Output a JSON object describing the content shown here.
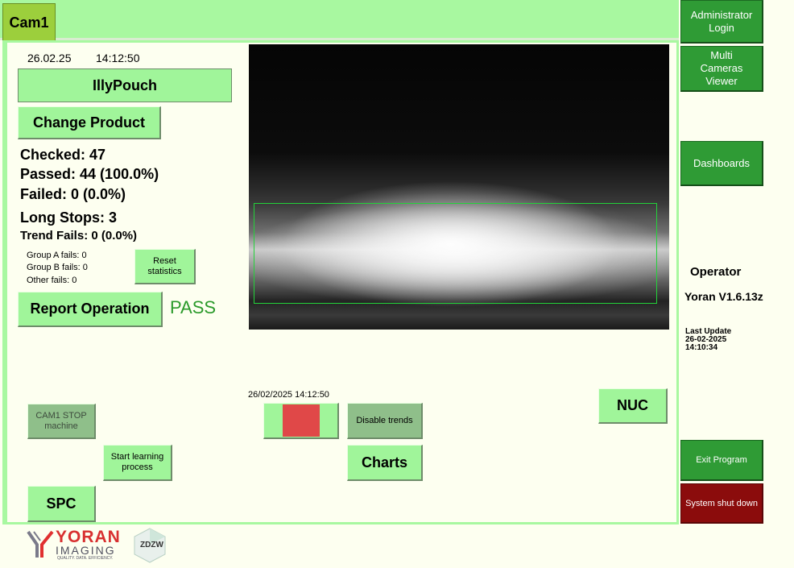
{
  "tab": {
    "label": "Cam1"
  },
  "header": {
    "date": "26.02.25",
    "time": "14:12:50"
  },
  "product": {
    "name": "IllyPouch",
    "change_label": "Change Product"
  },
  "stats": {
    "checked": "Checked: 47",
    "passed": "Passed: 44 (100.0%)",
    "failed": "Failed: 0 (0.0%)",
    "long_stops": "Long Stops: 3",
    "trend_fails": "Trend Fails: 0 (0.0%)",
    "group_a": "Group A fails: 0",
    "group_b": "Group B fails: 0",
    "other": "Other fails: 0"
  },
  "buttons": {
    "reset": "Reset statistics",
    "report": "Report Operation",
    "cam_stop": "CAM1 STOP machine",
    "start_learning": "Start learning process",
    "spc": "SPC",
    "disable_trends": "Disable trends",
    "charts": "Charts",
    "nuc": "NUC"
  },
  "status": {
    "result": "PASS",
    "result_color": "#2a9a2a",
    "indicator_color": "#e04848"
  },
  "trend_timestamp": "26/02/2025 14:12:50",
  "sidebar": {
    "admin_login": "Administrator Login",
    "multi_cameras": "Multi Cameras Viewer",
    "dashboards": "Dashboards",
    "user_role": "Operator",
    "version": "Yoran V1.6.13z",
    "last_update_label": "Last Update",
    "last_update_date": "26-02-2025",
    "last_update_time": "14:10:34",
    "exit": "Exit Program",
    "shutdown": "System shut down"
  },
  "logos": {
    "yoran_line1": "YORAN",
    "yoran_line2": "IMAGING",
    "yoran_tagline": "QUALITY. DATA. EFFICIENCY.",
    "zdzw": "ZDZW"
  },
  "colors": {
    "button_green": "#a0f59a",
    "sidebar_green": "#2f9b35",
    "shutdown_red": "#8b0c0c",
    "background": "#fdfff0"
  }
}
